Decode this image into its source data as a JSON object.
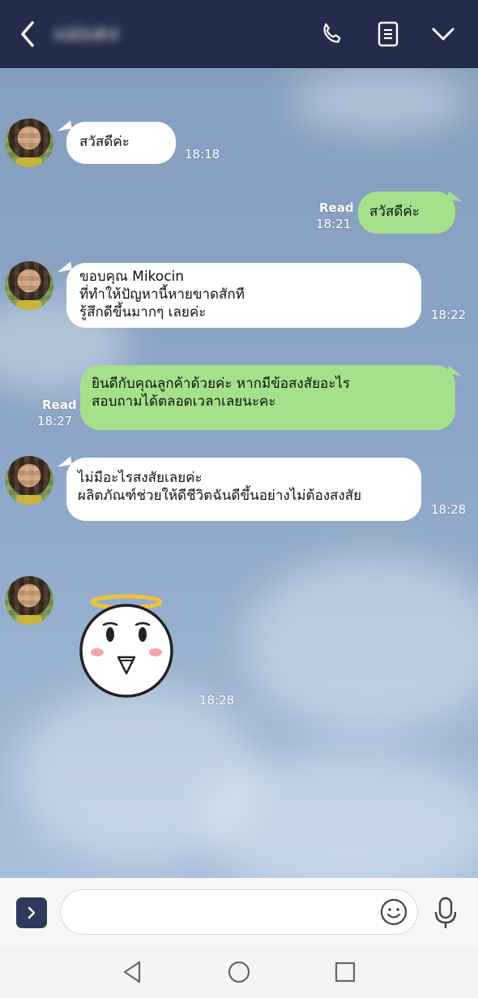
{
  "header": {
    "contact_name": "แม่แดง",
    "icons": [
      "back-arrow-icon",
      "phone-icon",
      "notes-icon",
      "chevron-down-icon"
    ]
  },
  "messages": [
    {
      "side": "in",
      "text": "สวัสดีค่ะ",
      "time": "18:18"
    },
    {
      "side": "out",
      "text": "สวัสดีค่ะ",
      "time": "18:21",
      "status": "Read"
    },
    {
      "side": "in",
      "text": "ขอบคุณ Mikocin\nที่ทำให้ปัญหานี้หายขาดสักที\nรู้สึกดีขึ้นมากๆ เลยค่ะ",
      "time": "18:22"
    },
    {
      "side": "out",
      "text": "ยินดีกับคุณลูกค้าด้วยค่ะ หากมีข้อสงสัยอะไร\nสอบถามได้ตลอดเวลาเลยนะคะ",
      "time": "18:27",
      "status": "Read"
    },
    {
      "side": "in",
      "text": "ไม่มีอะไรสงสัยเลยค่ะ\nผลิตภัณฑ์ช่วยให้ดีชีวิตฉันดีขึ้นอย่างไม่ต้องสงสัย",
      "time": "18:28"
    },
    {
      "side": "in",
      "type": "sticker",
      "sticker": "angel-face-sticker",
      "time": "18:28"
    }
  ],
  "input": {
    "placeholder": "",
    "value": ""
  },
  "colors": {
    "header": "#232d4b",
    "outgoing_bubble": "#a5e08a",
    "incoming_bubble": "#ffffff",
    "chat_bg": "#8ca5c6"
  }
}
